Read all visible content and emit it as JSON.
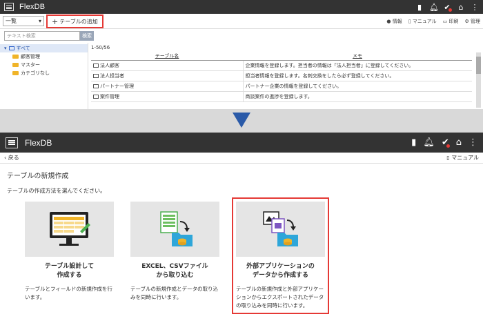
{
  "top": {
    "app_title": "FlexDB",
    "select_value": "一覧",
    "add_table": "テーブルの追加",
    "tools": [
      "情報",
      "マニュアル",
      "印刷",
      "管理"
    ],
    "search_placeholder": "テキスト検索",
    "search_button": "検索",
    "tree": [
      {
        "label": "すべて",
        "selected": true
      },
      {
        "label": "顧客管理"
      },
      {
        "label": "マスター"
      },
      {
        "label": "カテゴリなし"
      }
    ],
    "count": "1-50/56",
    "columns": [
      "テーブル名",
      "メモ"
    ],
    "rows": [
      [
        "法人顧客",
        "企業情報を登録します。担当者の情報は「法人担当者」に登録してください。"
      ],
      [
        "法人担当者",
        "担当者情報を登録します。名刺交換をしたら必ず登録してください。"
      ],
      [
        "パートナー管理",
        "パートナー企業の情報を登録してください。"
      ],
      [
        "案件管理",
        "商談案件の進捗を登録します。"
      ]
    ]
  },
  "bottom": {
    "app_title": "FlexDB",
    "back": "戻る",
    "manual": "マニュアル",
    "heading": "テーブルの新規作成",
    "instruction": "テーブルの作成方法を選んでください。",
    "cards": [
      {
        "title1": "テーブル設計して",
        "title2": "作成する",
        "desc": "テーブルとフィールドの新規作成を行います。",
        "icon": "monitor-table-icon"
      },
      {
        "title1": "EXCEL、CSVファイル",
        "title2": "から取り込む",
        "desc": "テーブルの新規作成とデータの取り込みを同時に行います。",
        "icon": "spreadsheet-import-icon"
      },
      {
        "title1": "外部アプリケーションの",
        "title2": "データから作成する",
        "desc": "テーブルの新規作成と外部アプリケーションからエクスポートされたデータの取り込みを同時に行います。",
        "icon": "external-app-import-icon"
      }
    ]
  },
  "colors": {
    "highlight": "#e53935",
    "appbar": "#333333",
    "arrow": "#2a5aa8"
  }
}
